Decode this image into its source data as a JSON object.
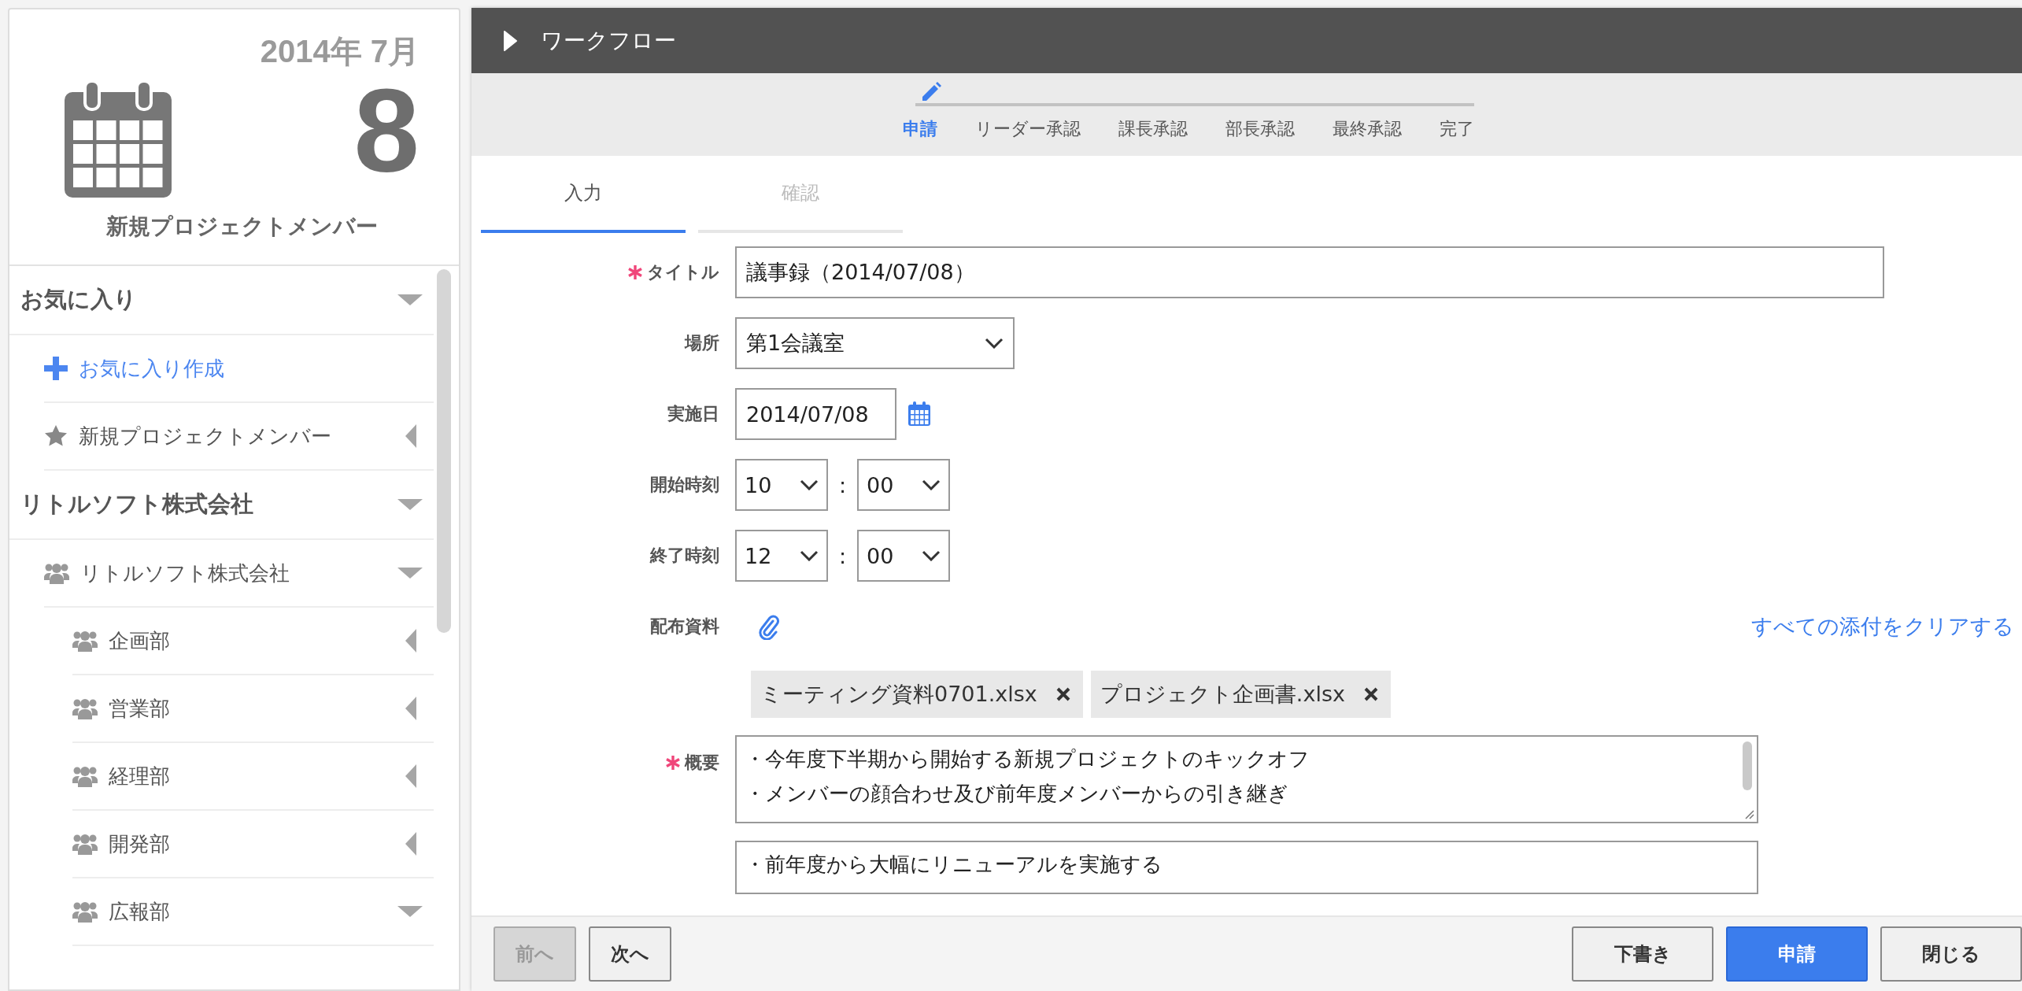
{
  "calendar": {
    "year_month": "2014年 7月",
    "day": "8",
    "title": "新規プロジェクトメンバー"
  },
  "sidebar": {
    "sections": [
      {
        "title": "お気に入り",
        "expanded": true,
        "items": [
          {
            "kind": "add",
            "label": "お気に入り作成"
          },
          {
            "kind": "favorite",
            "label": "新規プロジェクトメンバー",
            "expanded": false
          }
        ]
      },
      {
        "title": "リトルソフト株式会社",
        "expanded": true,
        "items": [
          {
            "kind": "group",
            "label": "リトルソフト株式会社",
            "expanded": true,
            "children": [
              {
                "kind": "group",
                "label": "企画部",
                "expanded": false
              },
              {
                "kind": "group",
                "label": "営業部",
                "expanded": false
              },
              {
                "kind": "group",
                "label": "経理部",
                "expanded": false
              },
              {
                "kind": "group",
                "label": "開発部",
                "expanded": false
              },
              {
                "kind": "group",
                "label": "広報部",
                "expanded": true
              }
            ]
          }
        ]
      }
    ]
  },
  "window": {
    "title": "ワークフロー"
  },
  "steps": [
    {
      "label": "申請",
      "selected": true
    },
    {
      "label": "リーダー承認",
      "selected": false
    },
    {
      "label": "課長承認",
      "selected": false
    },
    {
      "label": "部長承認",
      "selected": false
    },
    {
      "label": "最終承認",
      "selected": false
    },
    {
      "label": "完了",
      "selected": false
    }
  ],
  "tabs": [
    {
      "label": "入力",
      "selected": true
    },
    {
      "label": "確認",
      "selected": false
    }
  ],
  "form": {
    "fields": [
      {
        "kind": "text",
        "label": "タイトル",
        "required": true,
        "value": "議事録（2014/07/08）"
      },
      {
        "kind": "select",
        "label": "場所",
        "required": false,
        "value": "第1会議室"
      },
      {
        "kind": "date",
        "label": "実施日",
        "required": false,
        "value": "2014/07/08"
      },
      {
        "kind": "time",
        "label": "開始時刻",
        "required": false,
        "hour": "10",
        "separator": ":",
        "minute": "00"
      },
      {
        "kind": "time",
        "label": "終了時刻",
        "required": false,
        "hour": "12",
        "separator": ":",
        "minute": "00"
      },
      {
        "kind": "attachments",
        "label": "配布資料",
        "required": false,
        "clear_link": "すべての添付をクリアする",
        "files": [
          "ミーティング資料0701.xlsx",
          "プロジェクト企画書.xlsx"
        ]
      },
      {
        "kind": "textarea",
        "label": "概要",
        "required": true,
        "lines": [
          "・今年度下半期から開始する新規プロジェクトのキックオフ",
          "・メンバーの顔合わせ及び前年度メンバーからの引き継ぎ"
        ]
      },
      {
        "kind": "textarea",
        "required": false,
        "lines": [
          "・前年度から大幅にリニューアルを実施する"
        ]
      }
    ]
  },
  "footer": {
    "left_buttons": [
      {
        "label": "前へ",
        "primary": false,
        "disabled": true
      },
      {
        "label": "次へ",
        "primary": false,
        "disabled": false
      }
    ],
    "right_buttons": [
      {
        "label": "下書き",
        "primary": false,
        "disabled": false
      },
      {
        "label": "申請",
        "primary": true,
        "disabled": false
      },
      {
        "label": "閉じる",
        "primary": false,
        "disabled": false
      }
    ]
  }
}
